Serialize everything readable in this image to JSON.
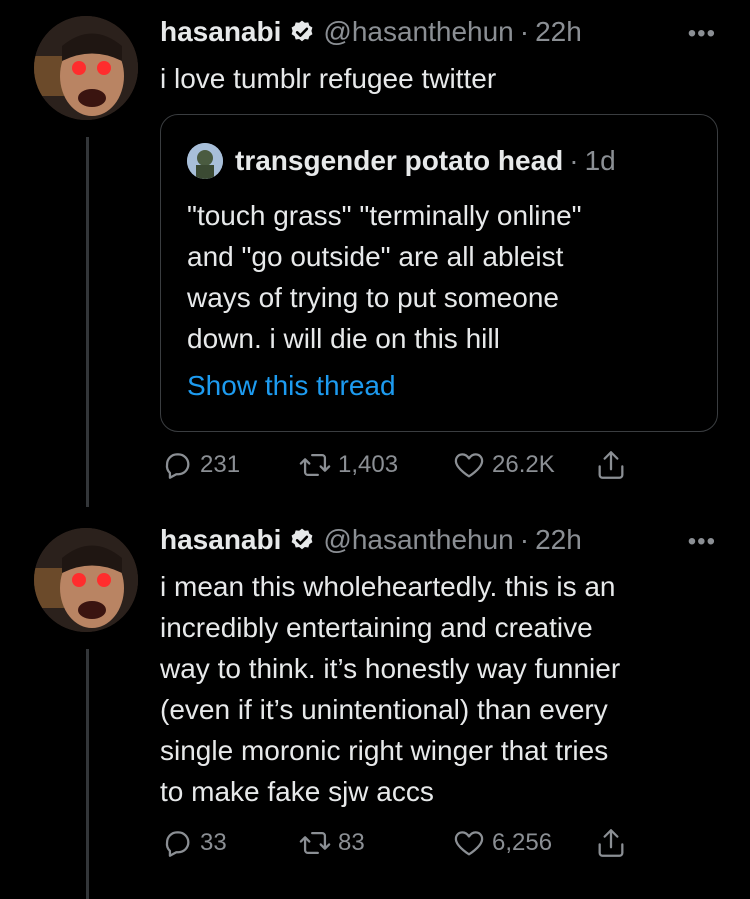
{
  "tweets": [
    {
      "name": "hasanabi",
      "handle": "@hasanthehun",
      "dot": "·",
      "time": "22h",
      "more": "•••",
      "text": "i love tumblr refugee twitter",
      "quote": {
        "name": "transgender potato head",
        "dot": "·",
        "time": "1d",
        "lines": [
          "\"touch grass\" \"terminally online\"",
          "and \"go outside\" are all ableist",
          "ways of trying to put someone",
          "down. i will die on this hill"
        ],
        "show_thread": "Show this thread"
      },
      "actions": {
        "replies": "231",
        "retweets": "1,403",
        "likes": "26.2K"
      }
    },
    {
      "name": "hasanabi",
      "handle": "@hasanthehun",
      "dot": "·",
      "time": "22h",
      "more": "•••",
      "lines": [
        "i mean this wholeheartedly. this is an",
        "incredibly entertaining and creative",
        "way to think. it’s honestly way funnier",
        "(even if it’s unintentional) than every",
        "single moronic right winger that tries",
        "to make fake sjw accs"
      ],
      "actions": {
        "replies": "33",
        "retweets": "83",
        "likes": "6,256"
      }
    }
  ],
  "colors": {
    "background": "#000000",
    "text": "#e7e9ea",
    "muted": "#8b8f94",
    "link": "#1d9bf0",
    "verified": "#e7e9ea"
  },
  "icons": [
    "verified-badge-icon",
    "more-icon",
    "reply-icon",
    "retweet-icon",
    "like-icon",
    "share-icon"
  ]
}
